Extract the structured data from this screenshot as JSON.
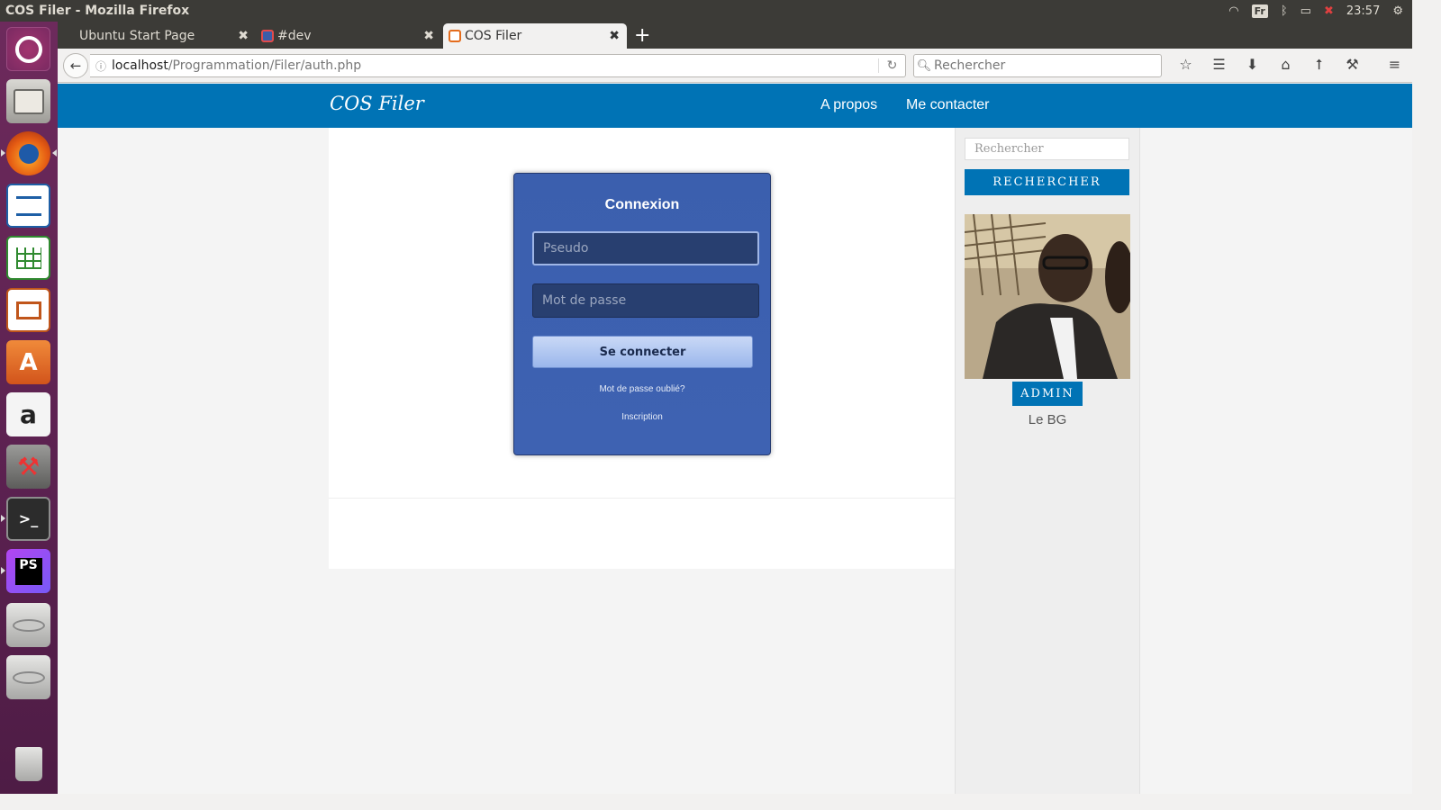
{
  "system": {
    "window_title": "COS Filer - Mozilla Firefox",
    "keyboard_layout": "Fr",
    "clock": "23:57"
  },
  "launcher": {
    "items": [
      "ubuntu-dash",
      "files",
      "firefox",
      "writer",
      "calc",
      "impress",
      "software-center",
      "amazon",
      "system-settings",
      "terminal",
      "phpstorm",
      "disk-1",
      "disk-2",
      "trash"
    ]
  },
  "browser": {
    "tabs": [
      {
        "label": "Ubuntu Start Page"
      },
      {
        "label": "#dev"
      },
      {
        "label": "COS Filer"
      }
    ],
    "new_tab_label": "+",
    "url_host": "localhost",
    "url_path": "/Programmation/Filer/auth.php",
    "search_placeholder": "Rechercher"
  },
  "site": {
    "brand": "COS Filer",
    "nav": [
      "A propos",
      "Me contacter"
    ],
    "login": {
      "title": "Connexion",
      "username_placeholder": "Pseudo",
      "password_placeholder": "Mot de passe",
      "submit_label": "Se connecter",
      "forgot_link": "Mot de passe oublié?",
      "register_link": "Inscription"
    },
    "sidebar": {
      "search_placeholder": "Rechercher",
      "search_button": "RECHERCHER",
      "role_badge": "ADMIN",
      "user_name": "Le BG"
    }
  },
  "colors": {
    "brand_blue": "#0073b5",
    "login_panel": "#3d61b1",
    "launcher": "#5e2352"
  }
}
